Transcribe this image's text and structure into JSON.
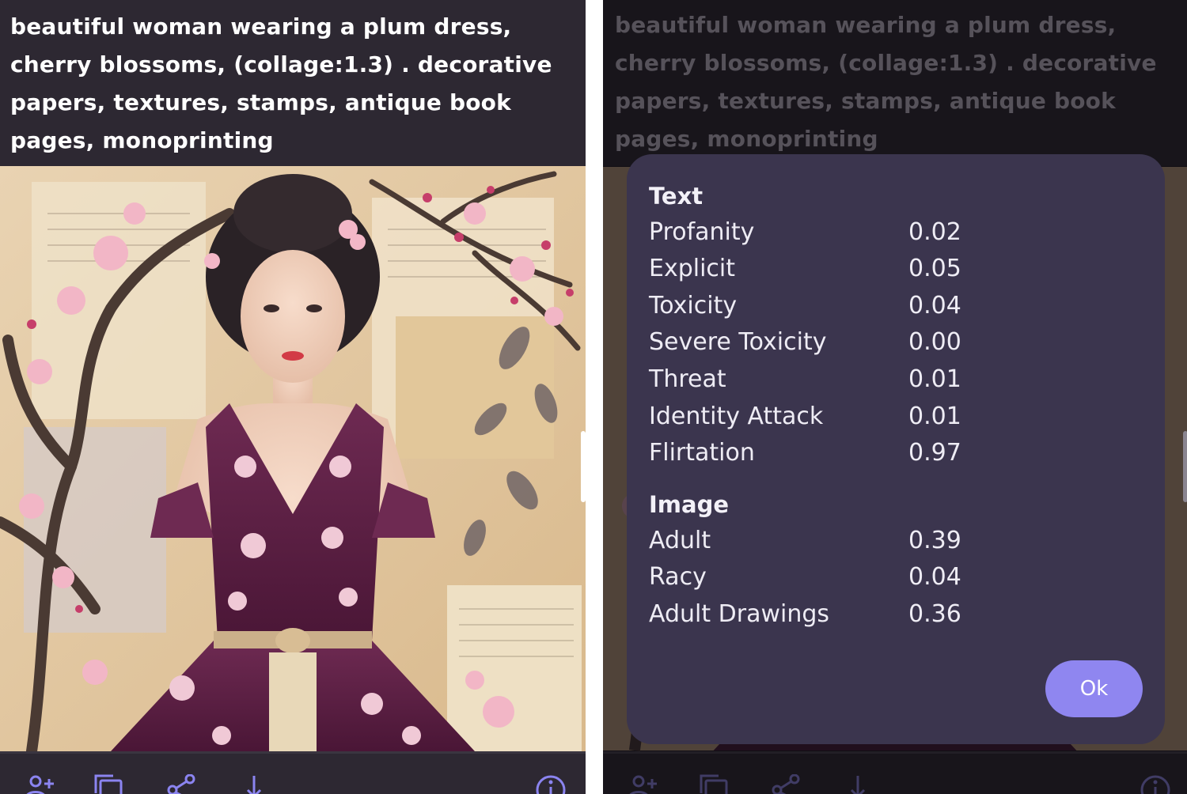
{
  "prompt_text": "beautiful woman wearing a plum dress, cherry blossoms, (collage:1.3) . decorative papers, textures, stamps, antique book pages, monoprinting",
  "toolbar": {
    "icons": [
      "add-user-icon",
      "copy-icon",
      "share-icon",
      "download-icon",
      "info-icon"
    ]
  },
  "moderation_dialog": {
    "text_section": {
      "title": "Text",
      "rows": [
        {
          "label": "Profanity",
          "value": "0.02"
        },
        {
          "label": "Explicit",
          "value": "0.05"
        },
        {
          "label": "Toxicity",
          "value": "0.04"
        },
        {
          "label": "Severe Toxicity",
          "value": "0.00"
        },
        {
          "label": "Threat",
          "value": "0.01"
        },
        {
          "label": "Identity Attack",
          "value": "0.01"
        },
        {
          "label": "Flirtation",
          "value": "0.97"
        }
      ]
    },
    "image_section": {
      "title": "Image",
      "rows": [
        {
          "label": "Adult",
          "value": "0.39"
        },
        {
          "label": "Racy",
          "value": "0.04"
        },
        {
          "label": "Adult Drawings",
          "value": "0.36"
        }
      ]
    },
    "ok_label": "Ok"
  },
  "colors": {
    "accent": "#8f86f0",
    "dialog_bg": "#3b354e",
    "panel_bg": "#2d2832",
    "icon_color": "#8b84f0"
  }
}
